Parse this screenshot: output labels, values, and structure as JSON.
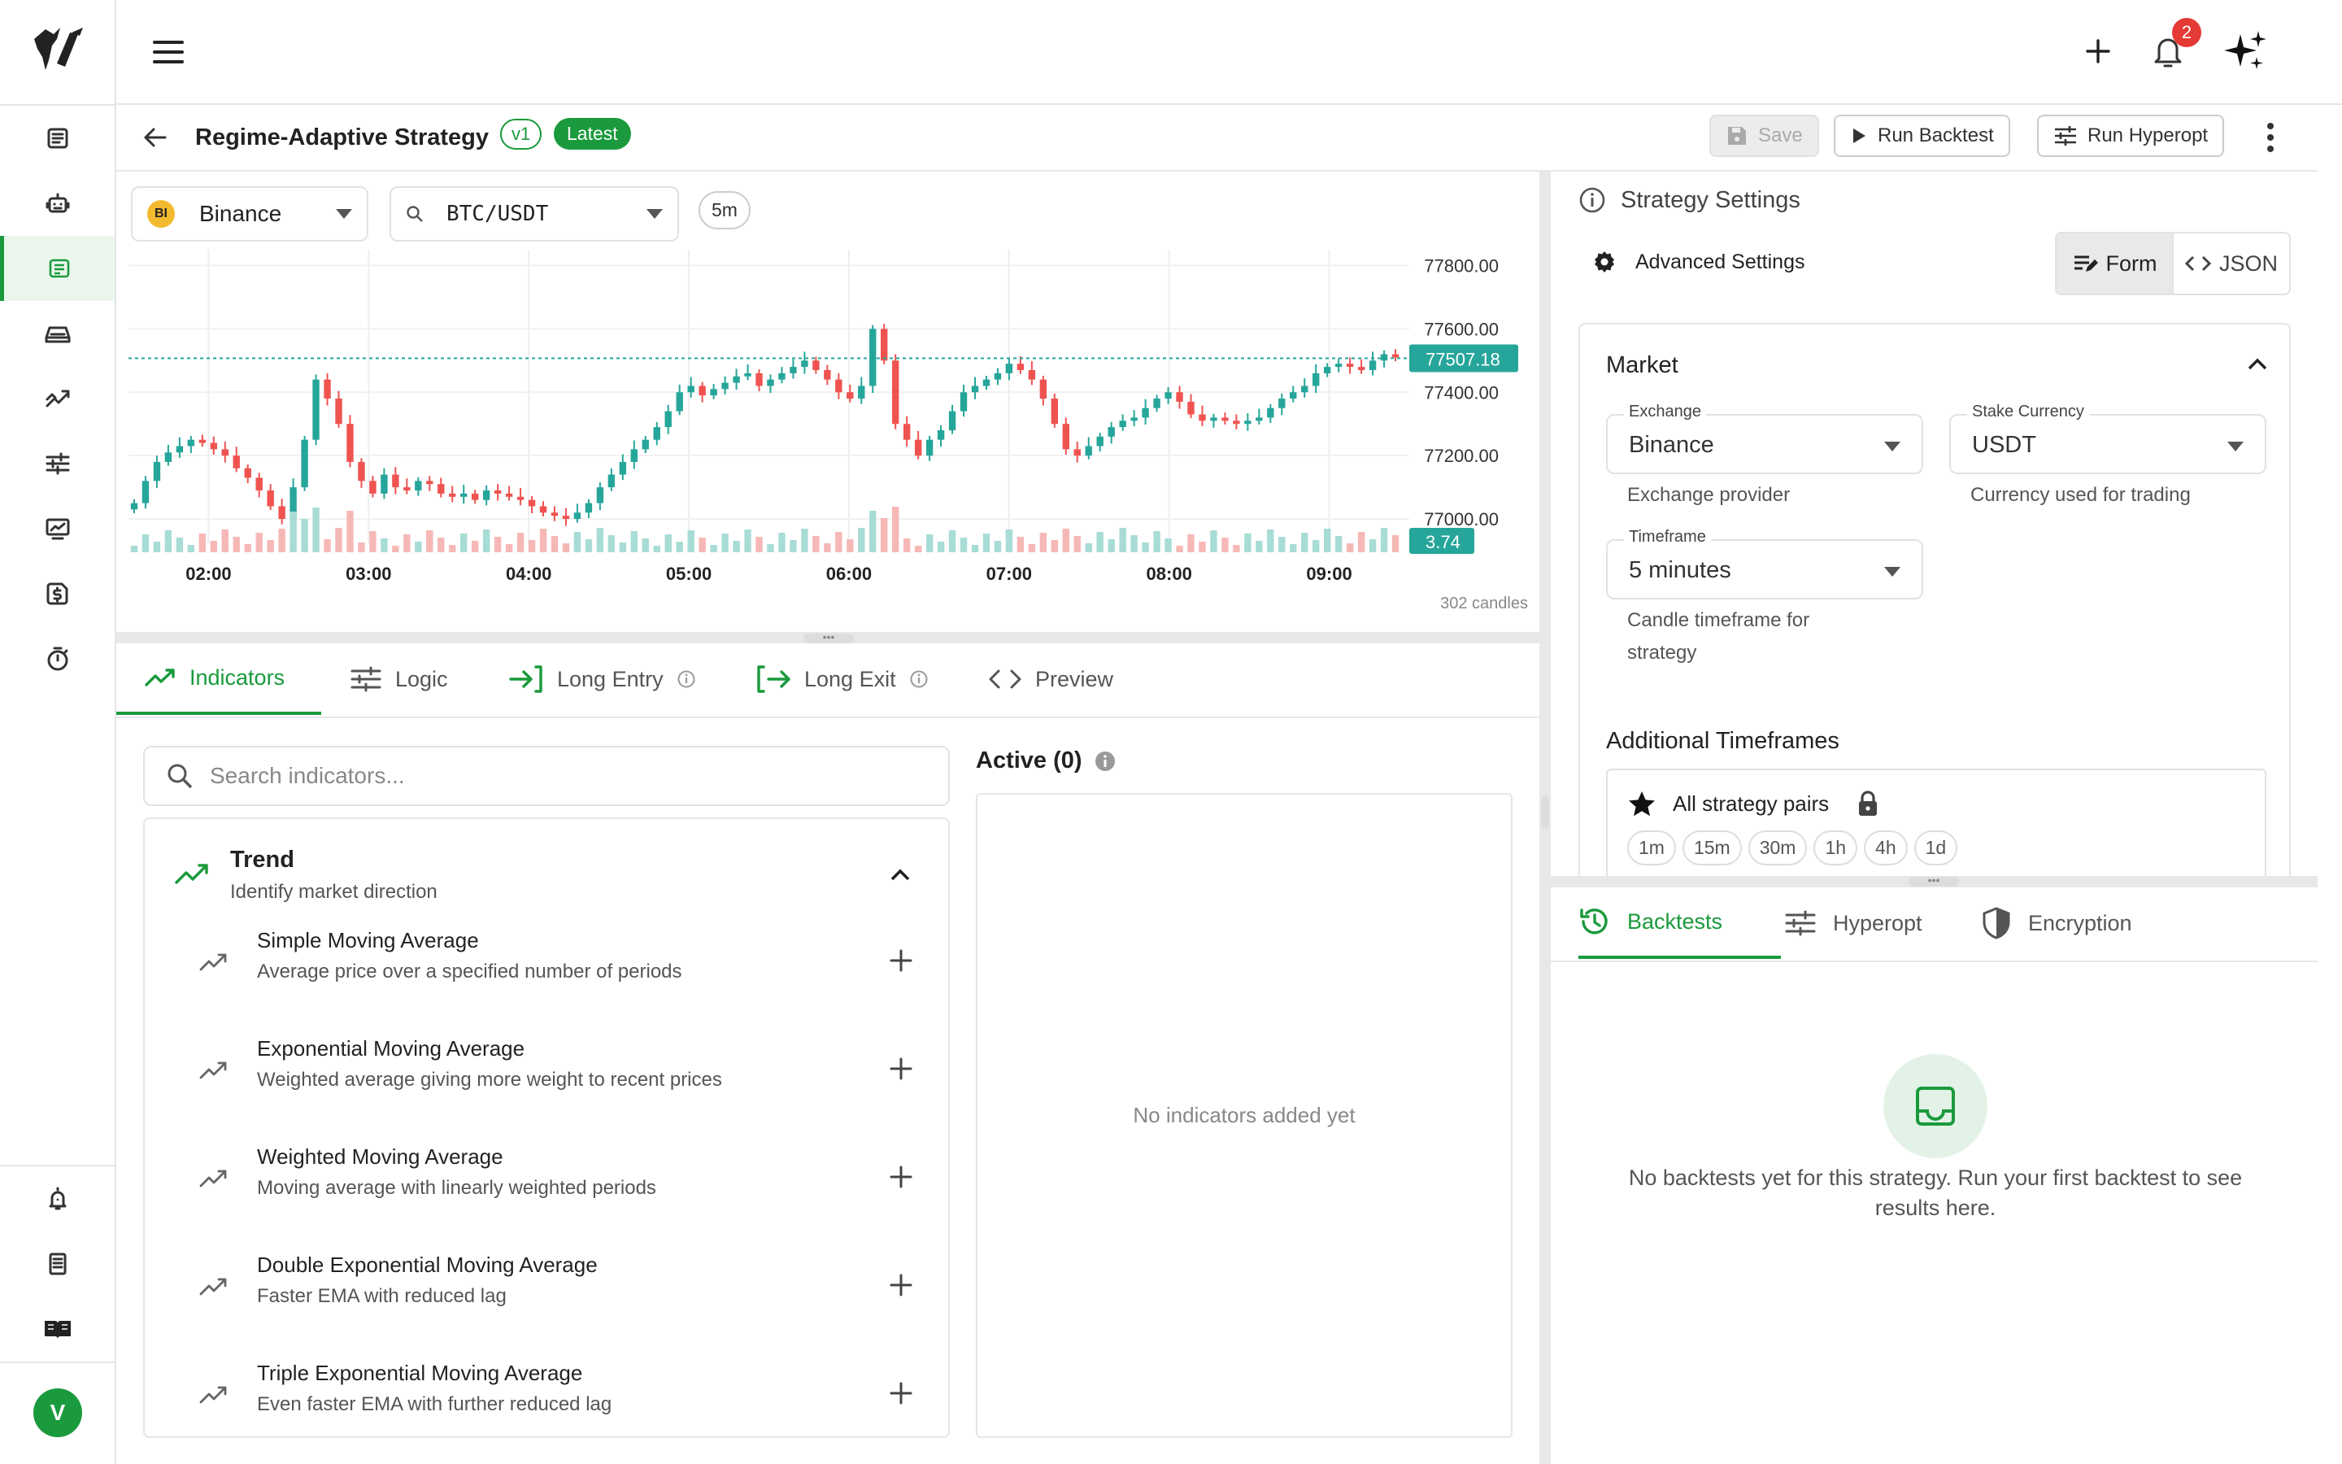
{
  "colors": {
    "accent": "#1a9a3c",
    "up": "#26a69a",
    "down": "#ef5350",
    "badge": "#e53935"
  },
  "sidebar": {
    "logo": "horse-logo",
    "items": [
      {
        "name": "dashboard",
        "icon": "dashboard-icon"
      },
      {
        "name": "bots",
        "icon": "robot-icon"
      },
      {
        "name": "strategies",
        "icon": "strategy-icon",
        "active": true
      },
      {
        "name": "exchanges",
        "icon": "exchange-icon"
      },
      {
        "name": "analytics",
        "icon": "analytics-icon"
      },
      {
        "name": "hyperopt",
        "icon": "sliders-icon"
      },
      {
        "name": "monitor",
        "icon": "monitor-icon"
      },
      {
        "name": "pricing",
        "icon": "dollar-icon"
      },
      {
        "name": "timer",
        "icon": "timer-icon"
      }
    ],
    "bottom": [
      {
        "name": "notifications",
        "icon": "bell-icon"
      },
      {
        "name": "docs",
        "icon": "document-icon"
      },
      {
        "name": "guide",
        "icon": "book-icon"
      }
    ],
    "avatar": "V"
  },
  "topbar": {
    "notification_count": "2"
  },
  "header": {
    "title": "Regime-Adaptive Strategy",
    "version": "v1",
    "latest": "Latest",
    "save": "Save",
    "run_backtest": "Run Backtest",
    "run_hyperopt": "Run Hyperopt"
  },
  "chart": {
    "exchange": "Binance",
    "exchange_badge": "BI",
    "pair": "BTC/USDT",
    "timeframe": "5m",
    "candles_label": "302 candles",
    "current_price_label": "77507.18",
    "volume_label": "3.74"
  },
  "chart_data": {
    "type": "candlestick",
    "x_ticks": [
      "02:00",
      "03:00",
      "04:00",
      "05:00",
      "06:00",
      "07:00",
      "08:00",
      "09:00"
    ],
    "y_ticks": [
      "77800.00",
      "77600.00",
      "77400.00",
      "77200.00",
      "77000.00"
    ],
    "ylim": [
      76900,
      77850
    ],
    "current_price": 77507.18,
    "last_volume": 3.74,
    "x_range": [
      "01:30",
      "09:30"
    ],
    "closes": [
      77050,
      77120,
      77180,
      77210,
      77230,
      77250,
      77240,
      77220,
      77200,
      77160,
      77130,
      77090,
      77040,
      77000,
      77100,
      77250,
      77440,
      77380,
      77300,
      77180,
      77120,
      77080,
      77140,
      77100,
      77090,
      77120,
      77110,
      77080,
      77070,
      77080,
      77060,
      77090,
      77080,
      77070,
      77060,
      77040,
      77020,
      77010,
      77000,
      77020,
      77050,
      77100,
      77140,
      77180,
      77220,
      77250,
      77290,
      77340,
      77400,
      77420,
      77390,
      77410,
      77430,
      77450,
      77460,
      77420,
      77440,
      77460,
      77480,
      77500,
      77470,
      77440,
      77400,
      77380,
      77420,
      77600,
      77500,
      77300,
      77250,
      77200,
      77250,
      77280,
      77340,
      77400,
      77420,
      77440,
      77460,
      77490,
      77470,
      77440,
      77380,
      77300,
      77220,
      77200,
      77230,
      77260,
      77290,
      77310,
      77320,
      77350,
      77380,
      77400,
      77370,
      77330,
      77310,
      77320,
      77310,
      77300,
      77310,
      77320,
      77350,
      77380,
      77400,
      77420,
      77460,
      77480,
      77490,
      77480,
      77470,
      77500,
      77520,
      77510
    ]
  },
  "tabs": [
    {
      "label": "Indicators",
      "icon": "trending-up-icon",
      "active": true
    },
    {
      "label": "Logic",
      "icon": "sliders-icon"
    },
    {
      "label": "Long Entry",
      "icon": "login-icon",
      "info": true
    },
    {
      "label": "Long Exit",
      "icon": "logout-icon",
      "info": true
    },
    {
      "label": "Preview",
      "icon": "code-icon"
    }
  ],
  "indicators": {
    "search_placeholder": "Search indicators...",
    "group_title": "Trend",
    "group_desc": "Identify market direction",
    "items": [
      {
        "name": "Simple Moving Average",
        "desc": "Average price over a specified number of periods"
      },
      {
        "name": "Exponential Moving Average",
        "desc": "Weighted average giving more weight to recent prices"
      },
      {
        "name": "Weighted Moving Average",
        "desc": "Moving average with linearly weighted periods"
      },
      {
        "name": "Double Exponential Moving Average",
        "desc": "Faster EMA with reduced lag"
      },
      {
        "name": "Triple Exponential Moving Average",
        "desc": "Even faster EMA with further reduced lag"
      }
    ],
    "active_label": "Active (0)",
    "empty": "No indicators added yet"
  },
  "settings": {
    "title": "Strategy Settings",
    "advanced": "Advanced Settings",
    "form": "Form",
    "json": "JSON",
    "market": "Market",
    "exchange_label": "Exchange",
    "exchange_value": "Binance",
    "exchange_help": "Exchange provider",
    "stake_label": "Stake Currency",
    "stake_value": "USDT",
    "stake_help": "Currency used for trading",
    "timeframe_label": "Timeframe",
    "timeframe_value": "5 minutes",
    "timeframe_help": "Candle timeframe for strategy",
    "additional": "Additional Timeframes",
    "all_pairs": "All strategy pairs",
    "tfs": [
      "1m",
      "15m",
      "30m",
      "1h",
      "4h",
      "1d"
    ]
  },
  "bottom_tabs": [
    {
      "label": "Backtests",
      "icon": "history-icon",
      "active": true
    },
    {
      "label": "Hyperopt",
      "icon": "sliders-icon"
    },
    {
      "label": "Encryption",
      "icon": "shield-icon"
    }
  ],
  "backtests": {
    "empty": "No backtests yet for this strategy. Run your first backtest to see results here."
  }
}
